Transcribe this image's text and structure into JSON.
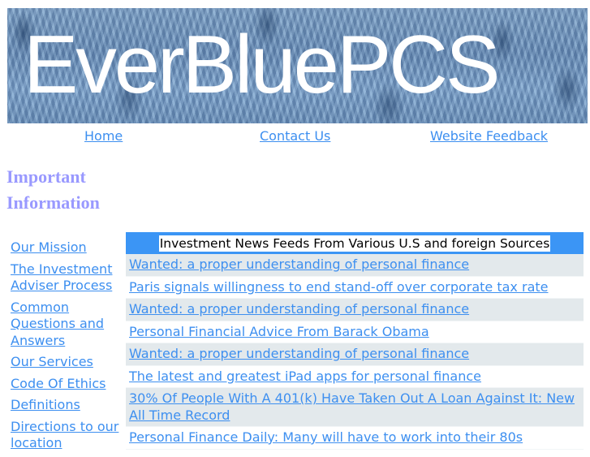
{
  "banner": {
    "title": "EverBluePCS"
  },
  "top_nav": {
    "items": [
      {
        "label": "Home"
      },
      {
        "label": "Contact Us"
      },
      {
        "label": "Website Feedback"
      }
    ]
  },
  "sidebar": {
    "heading": "Important Information",
    "items": [
      {
        "label": "Our Mission"
      },
      {
        "label": "The Investment Adviser Process"
      },
      {
        "label": "Common Questions and Answers"
      },
      {
        "label": "Our Services"
      },
      {
        "label": "Code Of Ethics"
      },
      {
        "label": "Definitions"
      },
      {
        "label": "Directions to our location"
      }
    ]
  },
  "news": {
    "header": "Investment News Feeds From Various U.S and foreign Sources",
    "items": [
      {
        "title": "Wanted: a proper understanding of personal finance"
      },
      {
        "title": "Paris signals willingness to end stand-off over corporate tax rate"
      },
      {
        "title": "Wanted: a proper understanding of personal finance"
      },
      {
        "title": "Personal Financial Advice From Barack Obama"
      },
      {
        "title": "Wanted: a proper understanding of personal finance"
      },
      {
        "title": "The latest and greatest iPad apps for personal finance"
      },
      {
        "title": "30% Of People With A 401(k) Have Taken Out A Loan Against It: New All Time Record"
      },
      {
        "title": "Personal Finance Daily: Many will have to work into their 80s"
      }
    ]
  },
  "colors": {
    "link": "#3d8ff0",
    "heading": "#9999ff",
    "news_header_bg": "#3b95f5",
    "alt_row_bg": "#e3e9ec"
  }
}
